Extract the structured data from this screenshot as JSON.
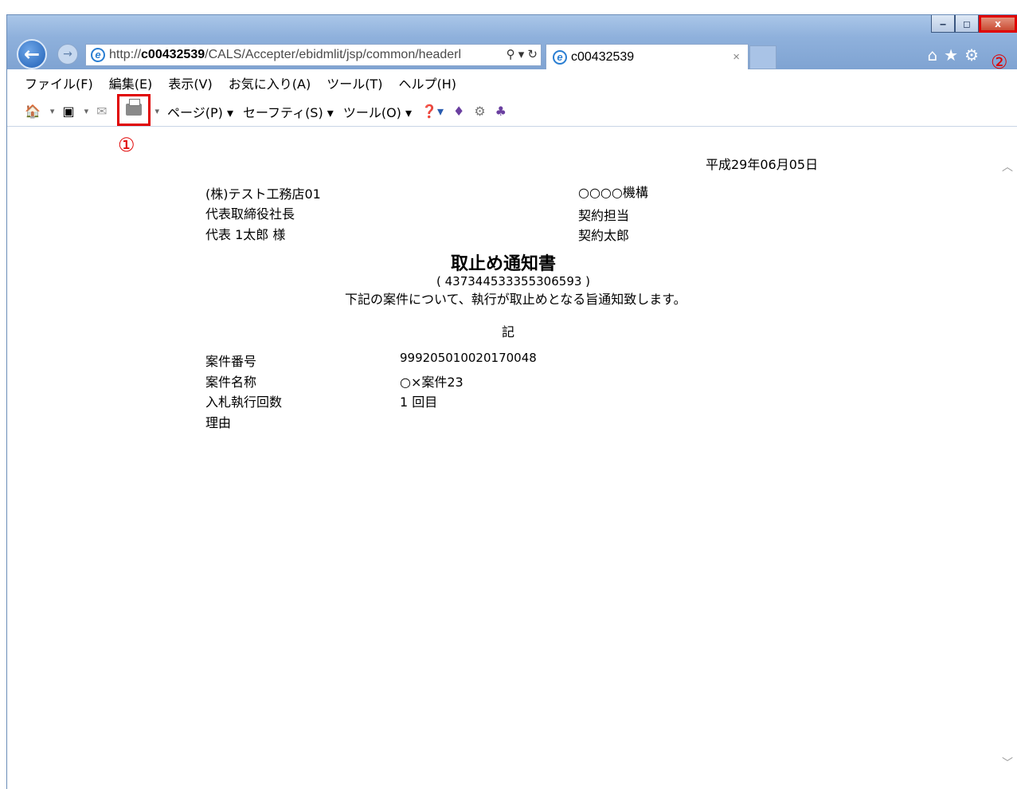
{
  "browser": {
    "address": {
      "prefix": "http://",
      "host": "c00432539",
      "path": "/CALS/Accepter/ebidmlit/jsp/common/headerl"
    },
    "tab_title": "c00432539",
    "window_buttons": {
      "min": "‒",
      "max": "◻",
      "close": "x"
    }
  },
  "menu": [
    "ファイル(F)",
    "編集(E)",
    "表示(V)",
    "お気に入り(A)",
    "ツール(T)",
    "ヘルプ(H)"
  ],
  "toolbar": {
    "page": "ページ(P) ▾",
    "safety": "セーフティ(S) ▾",
    "tools": "ツール(O) ▾"
  },
  "annotations": {
    "one": "①",
    "two": "②"
  },
  "document": {
    "date": "平成29年06月05日",
    "recipient_company": "(株)テスト工務店01",
    "recipient_title": "代表取締役社長",
    "recipient_name": "代表 1太郎 様",
    "sender_org": "○○○○機構",
    "sender_title": "契約担当",
    "sender_name": "契約太郎",
    "title": "取止め通知書",
    "doc_number": "( 437344533355306593 )",
    "lead": "下記の案件について、執行が取止めとなる旨通知致します。",
    "ki": "記",
    "fields": [
      {
        "label": "案件番号",
        "value": "999205010020170048"
      },
      {
        "label": "案件名称",
        "value": "○×案件23"
      },
      {
        "label": "入札執行回数",
        "value": "1 回目"
      },
      {
        "label": "理由",
        "value": ""
      }
    ]
  }
}
